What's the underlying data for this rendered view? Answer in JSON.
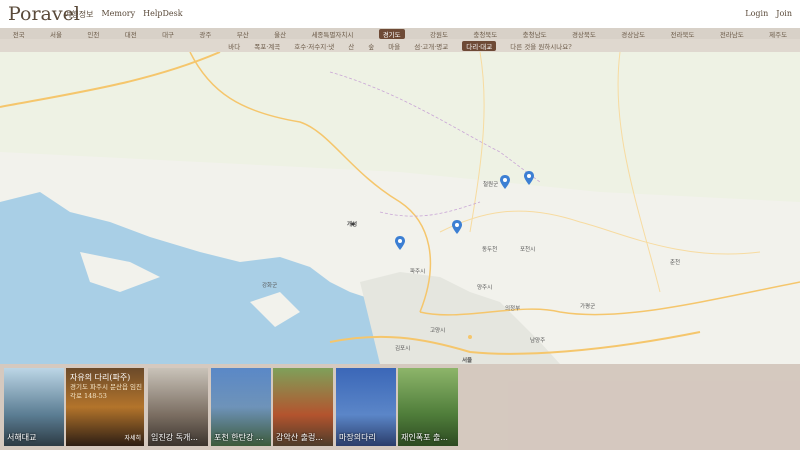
{
  "header": {
    "logo": "Poravel",
    "nav": [
      "여행정보",
      "Memory",
      "HelpDesk"
    ],
    "login": "Login",
    "join": "Join"
  },
  "regions": [
    "전국",
    "서울",
    "인천",
    "대전",
    "대구",
    "광주",
    "부산",
    "울산",
    "세종특별자치시",
    "경기도",
    "강원도",
    "충청북도",
    "충청남도",
    "경상북도",
    "경상남도",
    "전라북도",
    "전라남도",
    "제주도"
  ],
  "regions_active": "경기도",
  "categories": [
    "바다",
    "폭포·계곡",
    "호수·저수지·냇",
    "산",
    "숲",
    "마을",
    "섬·고개·명교",
    "다리·대교",
    "다른 것을 원하시나요?"
  ],
  "categories_active": "다리·대교",
  "map": {
    "labels": [
      "개성",
      "서울",
      "강화군",
      "파주시",
      "동두천",
      "포천시",
      "철원군",
      "양주시",
      "의정부",
      "김포시",
      "고양시",
      "남양주",
      "가평군",
      "춘천"
    ]
  },
  "cards": [
    {
      "label": "서해대교"
    },
    {
      "title": "자유의 다리(파주)",
      "address": "경기도 파주시 문산읍 임진각로 148-53",
      "more": "자세히"
    },
    {
      "label": "임진강 독개..."
    },
    {
      "label": "포천 한탄강 ..."
    },
    {
      "label": "감악산 출렁..."
    },
    {
      "label": "마장의다리"
    },
    {
      "label": "재인폭포 출..."
    }
  ]
}
